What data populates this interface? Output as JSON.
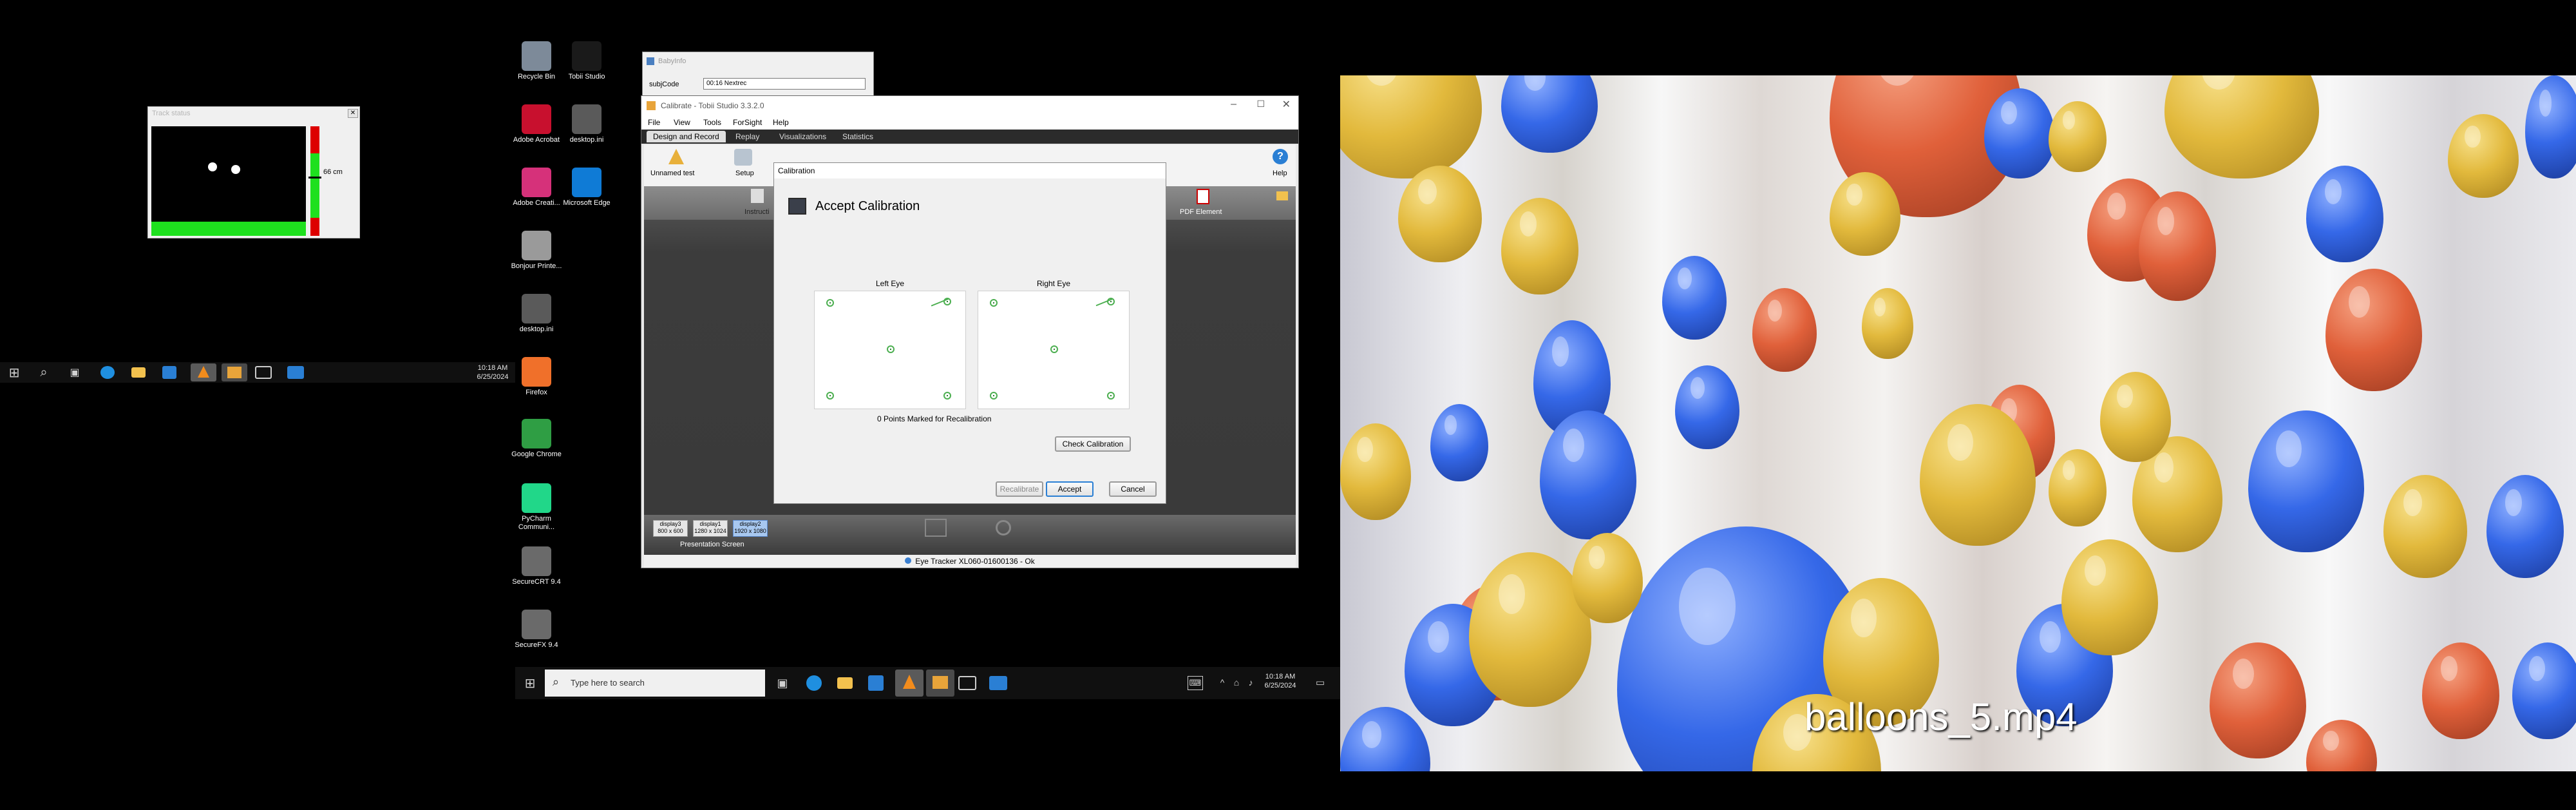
{
  "track_status": {
    "title": "Track status",
    "distance": "66 cm"
  },
  "taskbar_small": {
    "time": "10:18 AM",
    "date": "6/25/2024"
  },
  "desktop_icons": [
    {
      "label": "Recycle Bin",
      "color": "#7d8a99"
    },
    {
      "label": "Tobii Studio",
      "color": "#1a1a1a"
    },
    {
      "label": "Adobe Acrobat",
      "color": "#c8102e"
    },
    {
      "label": "desktop.ini",
      "color": "#5a5a5a"
    },
    {
      "label": "Adobe Creati...",
      "color": "#d6317a"
    },
    {
      "label": "Microsoft Edge",
      "color": "#0f7bd6"
    },
    {
      "label": "Bonjour Printe...",
      "color": "#9a9a9a"
    },
    {
      "label": "desktop.ini",
      "color": "#5a5a5a"
    },
    {
      "label": "Firefox",
      "color": "#f0702a"
    },
    {
      "label": "Google Chrome",
      "color": "#2f9e44"
    },
    {
      "label": "PyCharm Communi...",
      "color": "#21d789"
    },
    {
      "label": "SecureCRT 9.4",
      "color": "#6a6a6a"
    },
    {
      "label": "SecureFX 9.4",
      "color": "#6a6a6a"
    }
  ],
  "baby_info": {
    "title": "BabyInfo",
    "field_label": "subjCode",
    "field_value": "00:16 Nextrec"
  },
  "tobii": {
    "title": "Calibrate - Tobii Studio 3.3.2.0",
    "menu": [
      "File",
      "View",
      "Tools",
      "ForSight",
      "Help"
    ],
    "tabs": [
      "Design and Record",
      "Replay",
      "Visualizations",
      "Statistics"
    ],
    "ribbon": {
      "test": "Unnamed test",
      "setup": "Setup",
      "help": "Help",
      "pdf": "PDF Element",
      "instruct": "Instructi"
    },
    "displays": [
      {
        "name": "display3",
        "res": "800 x 600"
      },
      {
        "name": "display1",
        "res": "1280 x 1024"
      },
      {
        "name": "display2",
        "res": "1920 x 1080"
      }
    ],
    "presentation_screen": "Presentation Screen",
    "eyetracker_status": "Eye Tracker XL060-01600136 - Ok"
  },
  "calibration": {
    "title": "Calibration",
    "header": "Accept Calibration",
    "left_eye": "Left Eye",
    "right_eye": "Right Eye",
    "recal_text": "0 Points Marked for Recalibration",
    "check_button": "Check Calibration",
    "recalibrate_button": "Recalibrate",
    "accept_button": "Accept",
    "cancel_button": "Cancel"
  },
  "taskbar_main": {
    "search_placeholder": "Type here to search",
    "time": "10:18 AM",
    "date": "6/25/2024"
  },
  "video": {
    "caption": "balloons_5.mp4"
  }
}
